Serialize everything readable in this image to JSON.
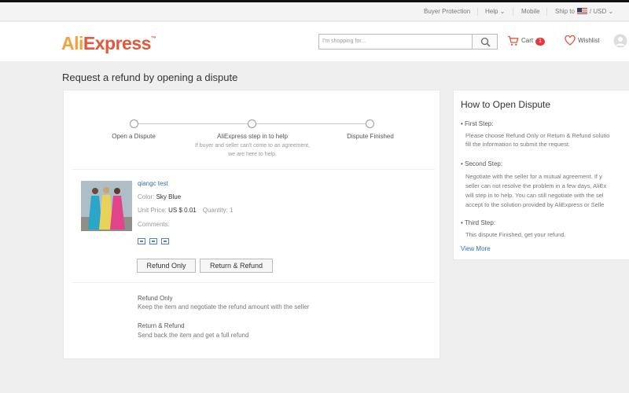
{
  "top_nav": {
    "buyer_protection": "Buyer Protection",
    "help": "Help",
    "mobile": "Mobile",
    "ship_to": "Ship to",
    "currency_sep": "/",
    "currency": "USD"
  },
  "header": {
    "logo_part1": "Ali",
    "logo_part2": "Express",
    "logo_tm": "™",
    "search_placeholder": "I'm shopping for...",
    "cart_label": "Cart",
    "cart_count": "1",
    "wishlist_label": "Wishlist"
  },
  "page": {
    "title": "Request a refund by opening a dispute"
  },
  "steps": [
    {
      "label": "Open a Dispute"
    },
    {
      "label": "AliExpress step in to help",
      "note": "If buyer and seller can't come to an agreement, we are here to help."
    },
    {
      "label": "Dispute Finished"
    }
  ],
  "product": {
    "name": "qiangc test",
    "color_label": "Color:",
    "color_value": "Sky Blue",
    "unit_price_label": "Unit Price:",
    "unit_price_value": "US $ 0.01",
    "quantity_label": "Quantity:",
    "quantity_value": "1",
    "comments_label": "Comments:"
  },
  "actions": {
    "refund_only": "Refund Only",
    "return_refund": "Return & Refund"
  },
  "info": {
    "refund_only_title": "Refund Only",
    "refund_only_desc": "Keep the item and negotiate the refund amount with the seller",
    "return_refund_title": "Return & Refund",
    "return_refund_desc": "Send back the item and get a full refund"
  },
  "sidebar": {
    "title": "How to Open Dispute",
    "first_step_title": "• First Step:",
    "first_step_lines": [
      "Please choose Refund Only or Return & Refund solutio",
      "fill the information to submit the request."
    ],
    "second_step_title": "• Second Step:",
    "second_step_lines": [
      "Negotiate with the seller for a mutual agreement. If y",
      "seller can not resolve the problem in a few days, AliEx",
      "will step in to help. You can still negotiate with the sel",
      "accept to the solution provided by AliExpress or Selle"
    ],
    "third_step_title": "• Third Step:",
    "third_step_text": "This dispute Finished, get your refund.",
    "view_more": "View More"
  },
  "colors": {
    "accent": "#e4573c",
    "brand_orange": "#f1a33c",
    "link": "#2c72b8",
    "page_bg": "#efefef"
  }
}
